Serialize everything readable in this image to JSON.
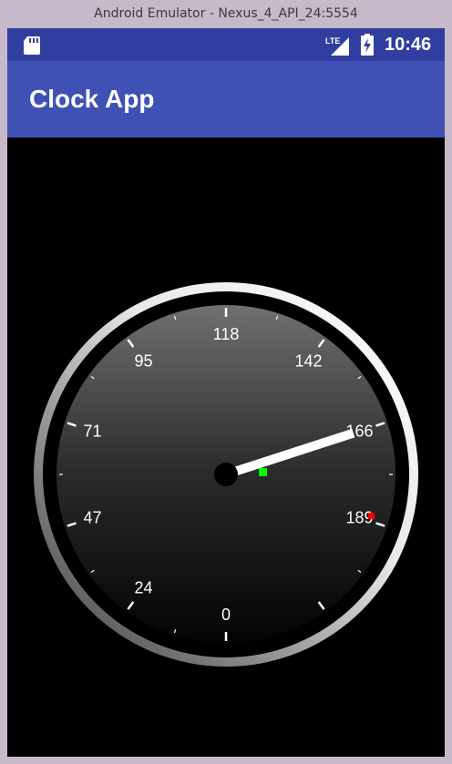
{
  "window": {
    "title": "Android Emulator - Nexus_4_API_24:5554"
  },
  "status_bar": {
    "time": "10:46",
    "network_label": "LTE",
    "icons": [
      "sd-card-icon",
      "lte-signal-icon",
      "battery-charging-icon"
    ]
  },
  "app_bar": {
    "title": "Clock App"
  },
  "gauge": {
    "labels": [
      {
        "value": "0",
        "angle": 0
      },
      {
        "value": "24",
        "angle": 36
      },
      {
        "value": "47",
        "angle": 72
      },
      {
        "value": "71",
        "angle": 108
      },
      {
        "value": "95",
        "angle": 144
      },
      {
        "value": "118",
        "angle": 180
      },
      {
        "value": "142",
        "angle": 216
      },
      {
        "value": "166",
        "angle": 252
      },
      {
        "value": "189",
        "angle": 288
      }
    ],
    "needle_value": 166,
    "colors": {
      "bezel": "#d0d0d0",
      "face_top": "#6e6e6e",
      "face_bottom": "#050505",
      "needle": "#ffffff",
      "hub": "#000000",
      "green_marker": "#00ff00",
      "red_marker": "#ff0000",
      "status_bar": "#303f9f",
      "app_bar": "#3f51b5"
    }
  }
}
